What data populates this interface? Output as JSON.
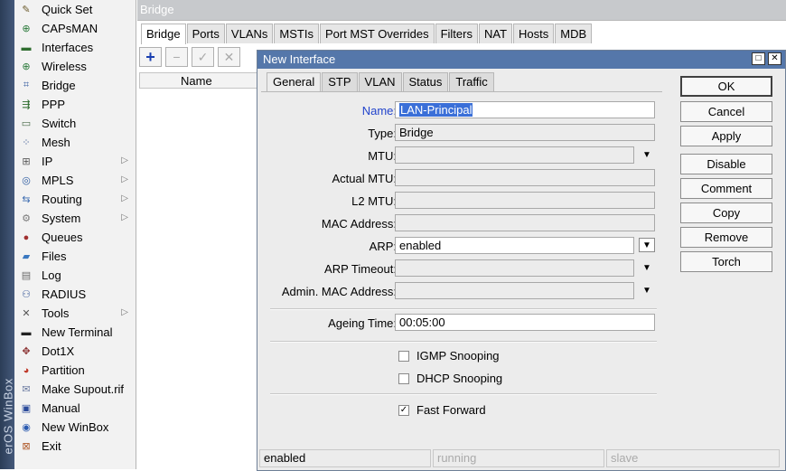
{
  "brand": {
    "strip_text": "erOS WinBox"
  },
  "menu": {
    "items": [
      {
        "name": "quick-set",
        "label": "Quick Set",
        "icon": "wand-icon",
        "glyph": "✎",
        "color": "#6b5a2a",
        "arrow": false
      },
      {
        "name": "capsman",
        "label": "CAPsMAN",
        "icon": "capsman-icon",
        "glyph": "⊕",
        "color": "#2a7a3a",
        "arrow": false
      },
      {
        "name": "interfaces",
        "label": "Interfaces",
        "icon": "interfaces-icon",
        "glyph": "▬",
        "color": "#2f6e2f",
        "arrow": false
      },
      {
        "name": "wireless",
        "label": "Wireless",
        "icon": "wireless-icon",
        "glyph": "⊕",
        "color": "#2a7a3a",
        "arrow": false
      },
      {
        "name": "bridge",
        "label": "Bridge",
        "icon": "bridge-icon",
        "glyph": "⌗",
        "color": "#3a5fa0",
        "arrow": false
      },
      {
        "name": "ppp",
        "label": "PPP",
        "icon": "ppp-icon",
        "glyph": "⇶",
        "color": "#2a6a2a",
        "arrow": false
      },
      {
        "name": "switch",
        "label": "Switch",
        "icon": "switch-icon",
        "glyph": "▭",
        "color": "#4a6a4a",
        "arrow": false
      },
      {
        "name": "mesh",
        "label": "Mesh",
        "icon": "mesh-icon",
        "glyph": "⁘",
        "color": "#2a4a8a",
        "arrow": false
      },
      {
        "name": "ip",
        "label": "IP",
        "icon": "ip-icon",
        "glyph": "⊞",
        "color": "#5a5a5a",
        "arrow": true
      },
      {
        "name": "mpls",
        "label": "MPLS",
        "icon": "mpls-icon",
        "glyph": "◎",
        "color": "#2a5aa0",
        "arrow": true
      },
      {
        "name": "routing",
        "label": "Routing",
        "icon": "routing-icon",
        "glyph": "⇆",
        "color": "#3a6ab0",
        "arrow": true
      },
      {
        "name": "system",
        "label": "System",
        "icon": "gear-icon",
        "glyph": "⚙",
        "color": "#7a7a7a",
        "arrow": true
      },
      {
        "name": "queues",
        "label": "Queues",
        "icon": "queues-icon",
        "glyph": "●",
        "color": "#a03030",
        "arrow": false
      },
      {
        "name": "files",
        "label": "Files",
        "icon": "folder-icon",
        "glyph": "▰",
        "color": "#3a78c0",
        "arrow": false
      },
      {
        "name": "log",
        "label": "Log",
        "icon": "log-icon",
        "glyph": "▤",
        "color": "#6a6a6a",
        "arrow": false
      },
      {
        "name": "radius",
        "label": "RADIUS",
        "icon": "radius-icon",
        "glyph": "⚇",
        "color": "#3a5a9a",
        "arrow": false
      },
      {
        "name": "tools",
        "label": "Tools",
        "icon": "tools-icon",
        "glyph": "✕",
        "color": "#555555",
        "arrow": true
      },
      {
        "name": "new-terminal",
        "label": "New Terminal",
        "icon": "terminal-icon",
        "glyph": "▬",
        "color": "#222222",
        "arrow": false
      },
      {
        "name": "dot1x",
        "label": "Dot1X",
        "icon": "dot1x-icon",
        "glyph": "✥",
        "color": "#8a3030",
        "arrow": false
      },
      {
        "name": "partition",
        "label": "Partition",
        "icon": "partition-icon",
        "glyph": "◕",
        "color": "#c03a2a",
        "arrow": false
      },
      {
        "name": "make-supout",
        "label": "Make Supout.rif",
        "icon": "supout-icon",
        "glyph": "✉",
        "color": "#6a7aa0",
        "arrow": false
      },
      {
        "name": "manual",
        "label": "Manual",
        "icon": "manual-icon",
        "glyph": "▣",
        "color": "#2a4a9a",
        "arrow": false
      },
      {
        "name": "new-winbox",
        "label": "New WinBox",
        "icon": "winbox-icon",
        "glyph": "◉",
        "color": "#2a5ab0",
        "arrow": false
      },
      {
        "name": "exit",
        "label": "Exit",
        "icon": "exit-icon",
        "glyph": "⊠",
        "color": "#b05a2a",
        "arrow": false
      }
    ]
  },
  "bridge_window": {
    "title": "Bridge",
    "tabs": [
      "Bridge",
      "Ports",
      "VLANs",
      "MSTIs",
      "Port MST Overrides",
      "Filters",
      "NAT",
      "Hosts",
      "MDB"
    ],
    "active_tab": "Bridge",
    "toolbar": {
      "add": "+",
      "remove": "−",
      "enable": "✓",
      "disable": "✕"
    },
    "table": {
      "column_name": "Name"
    }
  },
  "dialog": {
    "title": "New Interface",
    "controls": {
      "maximize": "□",
      "close": "✕"
    },
    "tabs": [
      "General",
      "STP",
      "VLAN",
      "Status",
      "Traffic"
    ],
    "active_tab": "General",
    "fields": {
      "name": {
        "label": "Name:",
        "value": "LAN-Principal"
      },
      "type": {
        "label": "Type:",
        "value": "Bridge"
      },
      "mtu": {
        "label": "MTU:",
        "value": ""
      },
      "actual_mtu": {
        "label": "Actual MTU:",
        "value": ""
      },
      "l2_mtu": {
        "label": "L2 MTU:",
        "value": ""
      },
      "mac_address": {
        "label": "MAC Address:",
        "value": ""
      },
      "arp": {
        "label": "ARP:",
        "value": "enabled"
      },
      "arp_timeout": {
        "label": "ARP Timeout:",
        "value": ""
      },
      "admin_mac": {
        "label": "Admin. MAC Address:",
        "value": ""
      },
      "ageing_time": {
        "label": "Ageing Time:",
        "value": "00:05:00"
      }
    },
    "checkboxes": {
      "igmp_snooping": {
        "label": "IGMP Snooping",
        "checked": false
      },
      "dhcp_snooping": {
        "label": "DHCP Snooping",
        "checked": false
      },
      "fast_forward": {
        "label": "Fast Forward",
        "checked": true
      }
    },
    "buttons": {
      "ok": "OK",
      "cancel": "Cancel",
      "apply": "Apply",
      "disable": "Disable",
      "comment": "Comment",
      "copy": "Copy",
      "remove": "Remove",
      "torch": "Torch"
    },
    "status": {
      "state": "enabled",
      "running": "running",
      "slave": "slave"
    }
  },
  "colors": {
    "title_active": "#5577aa",
    "label_highlight": "#2244cc",
    "selection_bg": "#3a6fd8"
  }
}
